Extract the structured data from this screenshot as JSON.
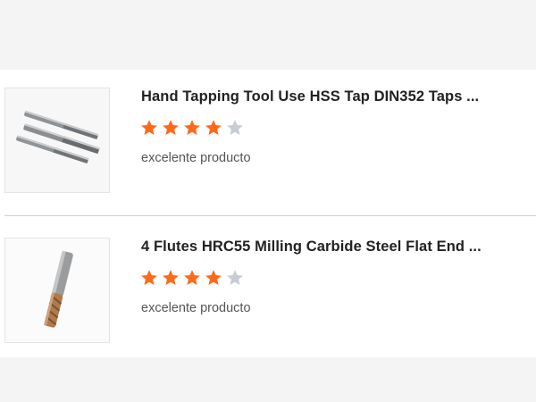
{
  "colors": {
    "star_filled": "#ff6a1a",
    "star_empty": "#c8ccd4",
    "title_text": "#222222",
    "comment_text": "#555555",
    "divider": "#d0d0d0"
  },
  "reviews": [
    {
      "product_title": "Hand Tapping Tool Use HSS Tap DIN352 Taps ...",
      "rating": 4,
      "rating_max": 5,
      "comment": "excelente producto",
      "image_icon": "hss-taps-image"
    },
    {
      "product_title": "4 Flutes HRC55 Milling Carbide Steel Flat End ...",
      "rating": 4,
      "rating_max": 5,
      "comment": "excelente producto",
      "image_icon": "end-mill-image"
    }
  ]
}
